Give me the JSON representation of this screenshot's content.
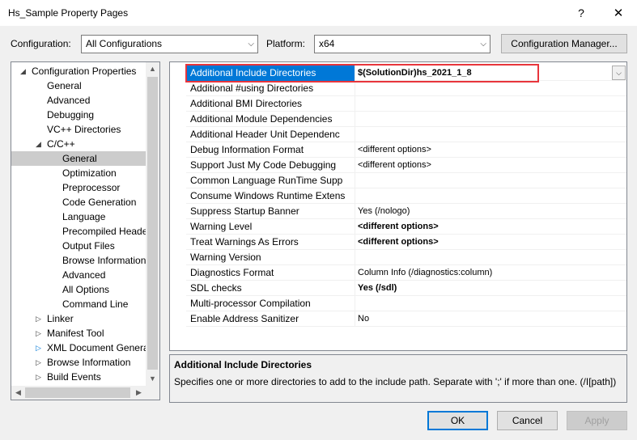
{
  "window": {
    "title": "Hs_Sample Property Pages",
    "help_glyph": "?",
    "close_glyph": "✕"
  },
  "config": {
    "configuration_label": "Configuration:",
    "configuration_value": "All Configurations",
    "platform_label": "Platform:",
    "platform_value": "x64",
    "manager_button": "Configuration Manager..."
  },
  "tree": {
    "items": [
      {
        "label": "Configuration Properties",
        "toggle": "◢"
      },
      {
        "label": "General"
      },
      {
        "label": "Advanced"
      },
      {
        "label": "Debugging"
      },
      {
        "label": "VC++ Directories"
      },
      {
        "label": "C/C++",
        "toggle": "◢"
      },
      {
        "label": "General",
        "selected": true
      },
      {
        "label": "Optimization"
      },
      {
        "label": "Preprocessor"
      },
      {
        "label": "Code Generation"
      },
      {
        "label": "Language"
      },
      {
        "label": "Precompiled Heade"
      },
      {
        "label": "Output Files"
      },
      {
        "label": "Browse Information"
      },
      {
        "label": "Advanced"
      },
      {
        "label": "All Options"
      },
      {
        "label": "Command Line"
      },
      {
        "label": "Linker",
        "toggle": "▷"
      },
      {
        "label": "Manifest Tool",
        "toggle": "▷"
      },
      {
        "label": "XML Document Genera",
        "toggle": "▷"
      },
      {
        "label": "Browse Information",
        "toggle": "▷"
      },
      {
        "label": "Build Events",
        "toggle": "▷"
      }
    ]
  },
  "grid": {
    "rows": [
      {
        "name": "Additional Include Directories",
        "value": "$(SolutionDir)hs_2021_1_8",
        "bold": true,
        "selected": true
      },
      {
        "name": "Additional #using Directories",
        "value": ""
      },
      {
        "name": "Additional BMI Directories",
        "value": ""
      },
      {
        "name": "Additional Module Dependencies",
        "value": ""
      },
      {
        "name": "Additional Header Unit Dependenc",
        "value": ""
      },
      {
        "name": "Debug Information Format",
        "value": "<different options>"
      },
      {
        "name": "Support Just My Code Debugging",
        "value": "<different options>"
      },
      {
        "name": "Common Language RunTime Supp",
        "value": ""
      },
      {
        "name": "Consume Windows Runtime Extens",
        "value": ""
      },
      {
        "name": "Suppress Startup Banner",
        "value": "Yes (/nologo)"
      },
      {
        "name": "Warning Level",
        "value": "<different options>",
        "bold": true
      },
      {
        "name": "Treat Warnings As Errors",
        "value": "<different options>",
        "bold": true
      },
      {
        "name": "Warning Version",
        "value": ""
      },
      {
        "name": "Diagnostics Format",
        "value": "Column Info (/diagnostics:column)"
      },
      {
        "name": "SDL checks",
        "value": "Yes (/sdl)",
        "bold": true
      },
      {
        "name": "Multi-processor Compilation",
        "value": ""
      },
      {
        "name": "Enable Address Sanitizer",
        "value": "No"
      }
    ]
  },
  "description": {
    "title": "Additional Include Directories",
    "text": "Specifies one or more directories to add to the include path. Separate with ';' if more than one.     (/I[path])"
  },
  "buttons": {
    "ok": "OK",
    "cancel": "Cancel",
    "apply": "Apply"
  }
}
